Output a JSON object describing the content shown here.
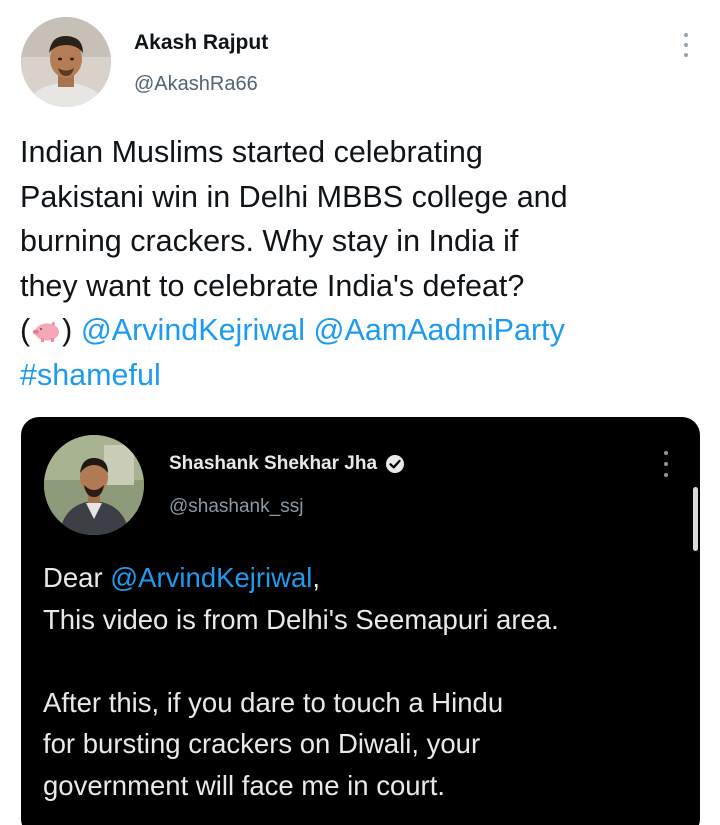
{
  "tweet": {
    "author": {
      "name": "Akash Rajput",
      "handle": "@AkashRa66"
    },
    "more_icon": "more-vertical-icon",
    "text": {
      "line1": "Indian Muslims started celebrating",
      "line2": "Pakistani win in Delhi MBBS college and",
      "line3": "burning crackers. Why stay in India if",
      "line4": "they want to celebrate India's defeat?",
      "line5_open": "(",
      "line5_emoji": "pig-emoji",
      "line5_close": ")",
      "mention1": "@ArvindKejriwal",
      "mention2": "@AamAadmiParty",
      "hashtag": "#shameful"
    }
  },
  "quoted_tweet": {
    "author": {
      "name": "Shashank Shekhar Jha",
      "handle": "@shashank_ssj",
      "verified_icon": "verified-badge-icon"
    },
    "more_icon": "more-vertical-icon",
    "text": {
      "line1_prefix": "Dear ",
      "mention": "@ArvindKejriwal",
      "line1_suffix": ",",
      "line2": "This video is from Delhi's Seemapuri area.",
      "line3": "After this, if you dare to touch a Hindu",
      "line4": "for bursting crackers on Diwali, your",
      "line5": "government will face me in court."
    }
  },
  "colors": {
    "link": "#1d9bf0",
    "text": "#0f1419",
    "secondary": "#536471",
    "quote_background": "#000000",
    "quote_text": "#e7e9ea"
  }
}
